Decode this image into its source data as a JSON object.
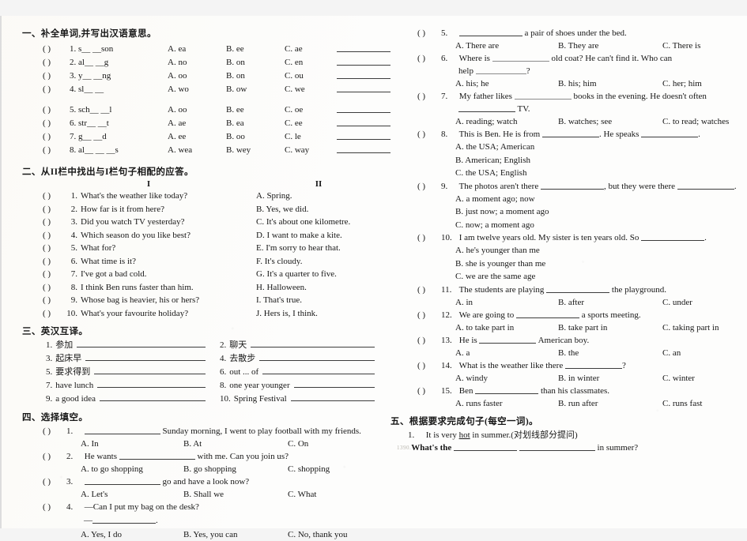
{
  "worksheet": {
    "sections": [
      {
        "id": "section-1",
        "heading": "一、补全单词,并写出汉语意思。",
        "items_group_a": [
          {
            "mark": "(   )",
            "num": "1.",
            "stem": "s__ __son",
            "a": "A. ea",
            "b": "B. ee",
            "c": "C. ae"
          },
          {
            "mark": "(   )",
            "num": "2.",
            "stem": "al__ __g",
            "a": "A. no",
            "b": "B. on",
            "c": "C. en"
          },
          {
            "mark": "(   )",
            "num": "3.",
            "stem": "y__ __ng",
            "a": "A. oo",
            "b": "B. on",
            "c": "C. ou"
          },
          {
            "mark": "(   )",
            "num": "4.",
            "stem": "sl__ __",
            "a": "A. wo",
            "b": "B. ow",
            "c": "C. we"
          }
        ],
        "items_group_b": [
          {
            "mark": "(   )",
            "num": "5.",
            "stem": "sch__ __l",
            "a": "A. oo",
            "b": "B. ee",
            "c": "C. oe"
          },
          {
            "mark": "(   )",
            "num": "6.",
            "stem": "str__ __t",
            "a": "A. ae",
            "b": "B. ea",
            "c": "C. ee"
          },
          {
            "mark": "(   )",
            "num": "7.",
            "stem": "g__ __d",
            "a": "A. ee",
            "b": "B. oo",
            "c": "C. le"
          },
          {
            "mark": "(   )",
            "num": "8.",
            "stem": "al__ __ __s",
            "a": "A. wea",
            "b": "B. wey",
            "c": "C. way"
          }
        ]
      },
      {
        "id": "section-2",
        "heading": "二、从II栏中找出与I栏句子相配的应答。",
        "col_head_left": "I",
        "col_head_right": "II",
        "rows": [
          {
            "mark": "(   )",
            "num": "1.",
            "left": "What's the weather like today?",
            "right": "A. Spring."
          },
          {
            "mark": "(   )",
            "num": "2.",
            "left": "How far is it from here?",
            "right": "B. Yes, we did."
          },
          {
            "mark": "(   )",
            "num": "3.",
            "left": "Did you watch TV yesterday?",
            "right": "C. It's about one kilometre."
          },
          {
            "mark": "(   )",
            "num": "4.",
            "left": "Which season do you like best?",
            "right": "D. I want to make a kite."
          },
          {
            "mark": "(   )",
            "num": "5.",
            "left": "What for?",
            "right": "E. I'm sorry to hear that."
          },
          {
            "mark": "(   )",
            "num": "6.",
            "left": "What time is it?",
            "right": "F. It's cloudy."
          },
          {
            "mark": "(   )",
            "num": "7.",
            "left": "I've got a bad cold.",
            "right": "G. It's a quarter to five."
          },
          {
            "mark": "(   )",
            "num": "8.",
            "left": "I think Ben runs faster than him.",
            "right": "H. Halloween."
          },
          {
            "mark": "(   )",
            "num": "9.",
            "left": "Whose bag is heavier, his or hers?",
            "right": "I.  That's true."
          },
          {
            "mark": "(   )",
            "num": "10.",
            "left": "What's your favourite holiday?",
            "right": "J.  Hers is, I think."
          }
        ]
      },
      {
        "id": "section-3",
        "heading": "三、英汉互译。",
        "rows": [
          {
            "ln": "1.",
            "lt": "参加",
            "rn": "2.",
            "rt": "聊天"
          },
          {
            "ln": "3.",
            "lt": "起床早",
            "rn": "4.",
            "rt": "去散步"
          },
          {
            "ln": "5.",
            "lt": "要求得到",
            "rn": "6.",
            "rt": "out ... of"
          },
          {
            "ln": "7.",
            "lt": "have lunch",
            "rn": "8.",
            "rt": "one year younger"
          },
          {
            "ln": "9.",
            "lt": "a good idea",
            "rn": "10.",
            "rt": "Spring Festival"
          }
        ]
      },
      {
        "id": "section-4",
        "heading": "四、选择填空。",
        "questions": [
          {
            "mark": "(   )",
            "num": "1.",
            "stem_before": "",
            "stem_after": " Sunday morning, I went to play football with my friends.",
            "options": [
              "A. In",
              "B. At",
              "C. On"
            ]
          },
          {
            "mark": "(   )",
            "num": "2.",
            "stem_before": "He wants ",
            "stem_after": " with me. Can you join us?",
            "options": [
              "A. to go shopping",
              "B. go shopping",
              "C. shopping"
            ]
          },
          {
            "mark": "(   )",
            "num": "3.",
            "stem_before": "",
            "stem_after": " go and have a look now?",
            "options": [
              "A. Let's",
              "B. Shall we",
              "C. What"
            ]
          },
          {
            "mark": "(   )",
            "num": "4.",
            "stem_before": "—Can I put my bag on the desk?",
            "stem_after": "",
            "second_line": "—",
            "options": [
              "A. Yes, I do",
              "B. Yes, you can",
              "C. No, thank you"
            ]
          },
          {
            "mark": "(   )",
            "num": "5.",
            "stem_before": "",
            "stem_after": " a pair of shoes under the bed.",
            "options": [
              "A. There are",
              "B. They are",
              "C. There is"
            ]
          },
          {
            "mark": "(   )",
            "num": "6.",
            "stem_before": "Where is ",
            "stem_after": " old coat? He can't find it. Who can",
            "second_line_before": "help ",
            "second_line_after": "?",
            "options": [
              "A. his; he",
              "B. his; him",
              "C. her; him"
            ]
          },
          {
            "mark": "(   )",
            "num": "7.",
            "stem_before": "My father likes ",
            "stem_after": " books in the evening. He doesn't often",
            "second_line_after": " TV.",
            "options": [
              "A. reading; watch",
              "B. watches; see",
              "C. to read; watches"
            ]
          },
          {
            "mark": "(   )",
            "num": "8.",
            "stem_before": "This is Ben. He is from ",
            "stem_mid": ". He speaks ",
            "stem_after": ".",
            "options_stacked": [
              "A. the USA; American",
              "B. American; English",
              "C. the USA; English"
            ]
          },
          {
            "mark": "(   )",
            "num": "9.",
            "stem_before": "The photos aren't there ",
            "stem_mid": ", but they were there ",
            "stem_after": ".",
            "options_stacked": [
              "A. a moment ago; now",
              "B. just now; a moment ago",
              "C. now; a moment ago"
            ]
          },
          {
            "mark": "(   )",
            "num": "10.",
            "stem_before": "I am twelve years old. My sister is ten years old. So ",
            "stem_after": ".",
            "options_stacked": [
              "A. he's younger than me",
              "B. she is younger than me",
              "C. we are the same age"
            ]
          },
          {
            "mark": "(   )",
            "num": "11.",
            "stem_before": "The students are playing ",
            "stem_after": " the playground.",
            "options": [
              "A. in",
              "B. after",
              "C. under"
            ]
          },
          {
            "mark": "(   )",
            "num": "12.",
            "stem_before": "We are going to ",
            "stem_after": " a sports meeting.",
            "options": [
              "A. to take part in",
              "B. take part in",
              "C. taking part in"
            ]
          },
          {
            "mark": "(   )",
            "num": "13.",
            "stem_before": "He is ",
            "stem_after": " American boy.",
            "options": [
              "A. a",
              "B. the",
              "C. an"
            ]
          },
          {
            "mark": "(   )",
            "num": "14.",
            "stem_before": "What is the weather like there ",
            "stem_after": "?",
            "options": [
              "A. windy",
              "B. in winter",
              "C. winter"
            ]
          },
          {
            "mark": "(   )",
            "num": "15.",
            "stem_before": "Ben ",
            "stem_after": " than his classmates.",
            "options": [
              "A. runs faster",
              "B. run after",
              "C. runs fast"
            ]
          }
        ]
      },
      {
        "id": "section-5",
        "heading": "五、根据要求完成句子(每空一词)。",
        "q1_num": "1.",
        "q1_before": "It is very ",
        "q1_underlined": "hot",
        "q1_after": " in summer.(对划线部分提问)",
        "q1_answer_before": "What's the ",
        "q1_answer_after": " in summer?",
        "ghost_mark": "1390."
      }
    ]
  }
}
